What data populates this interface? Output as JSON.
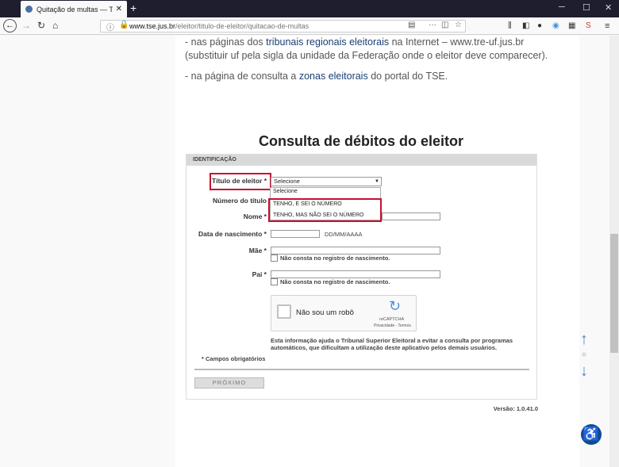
{
  "browser": {
    "tab_title": "Quitação de multas — Tribunal",
    "url_domain": "www.tse.jus.br",
    "url_path": "/eleitor/titulo-de-eleitor/quitacao-de-multas"
  },
  "content": {
    "para1_a": "- nas páginas dos ",
    "para1_link": "tribunais regionais eleitorais",
    "para1_b": " na Internet – www.tre-uf.jus.br (substituir uf pela sigla da unidade da Federação onde o eleitor deve comparecer).",
    "para2_a": "- na página de consulta a ",
    "para2_link": "zonas eleitorais",
    "para2_b": " do portal do TSE."
  },
  "form": {
    "heading": "Consulta de débitos do eleitor",
    "section": "IDENTIFICAÇÃO",
    "titulo_label": "Título de eleitor *",
    "select_value": "Selecione",
    "options": [
      "Selecione",
      "TENHO, E SEI O NÚMERO",
      "TENHO, MAS NÃO SEI O NÚMERO"
    ],
    "numero_label": "Número do título",
    "nome_label": "Nome *",
    "nascimento_label": "Data de nascimento *",
    "date_hint": "DD/MM/AAAA",
    "mae_label": "Mãe *",
    "pai_label": "Pai *",
    "nao_consta": "Não consta no registro de nascimento.",
    "captcha_text": "Não sou um robô",
    "captcha_brand": "reCAPTCHA",
    "captcha_links": "Privacidade - Termos",
    "info": "Esta informação ajuda o Tribunal Superior Eleitoral a evitar a consulta por programas automáticos, que dificultam a utilização deste aplicativo pelos demais usuários.",
    "required": "* Campos obrigatórios",
    "next_button": "PRÓXIMO",
    "version": "Versão: 1.0.41.0"
  }
}
